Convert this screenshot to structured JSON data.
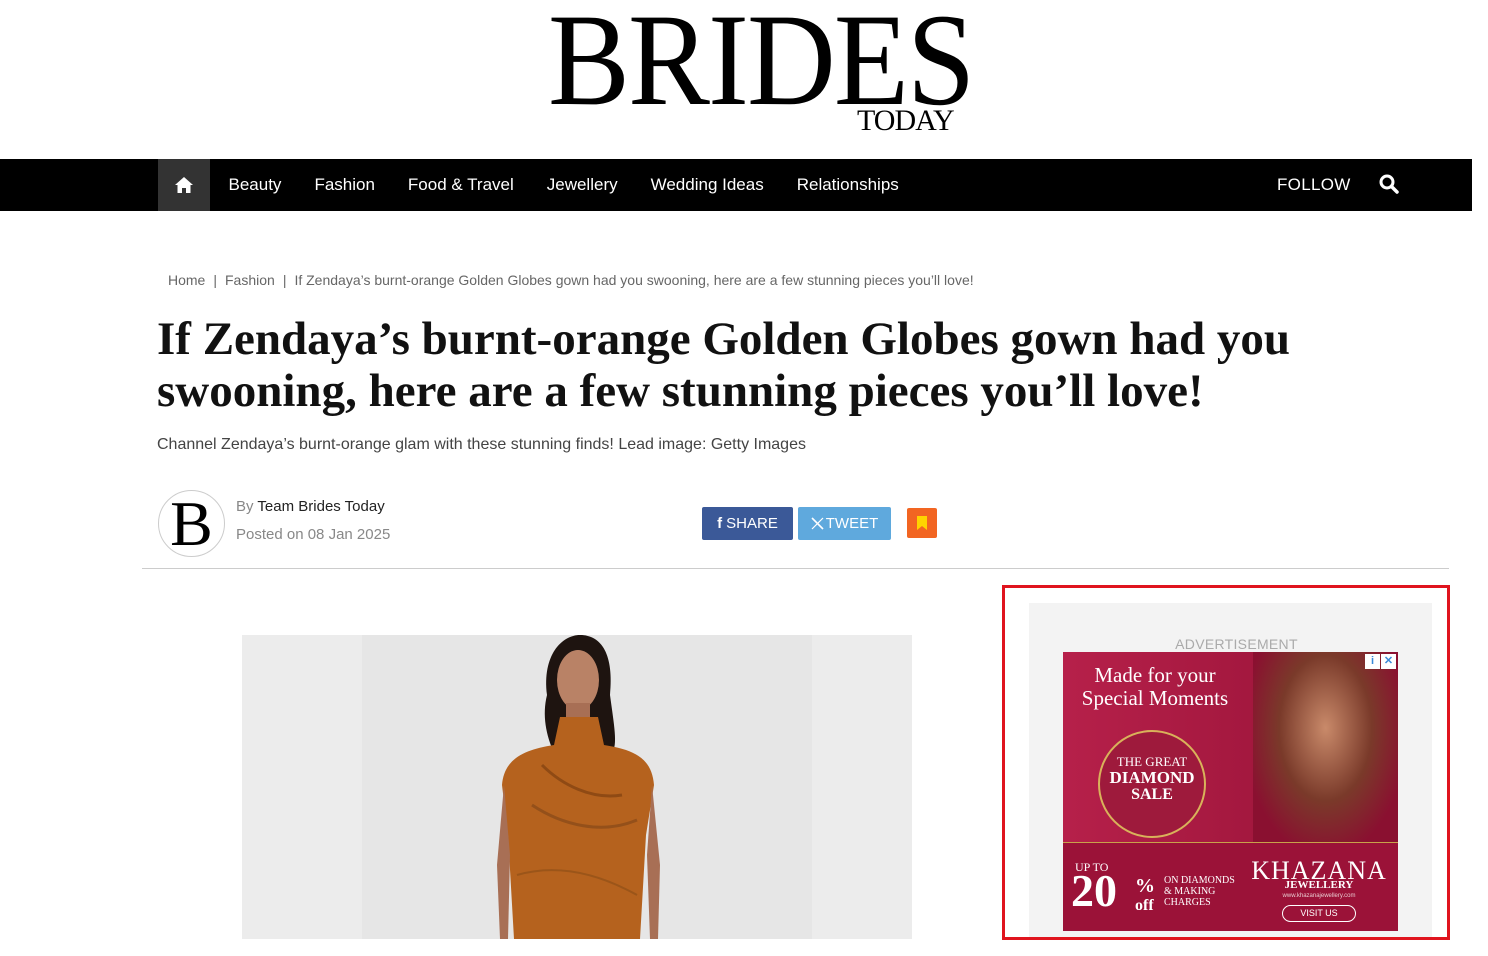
{
  "header": {
    "logo_main": "BRIDES",
    "logo_sub": "TODAY"
  },
  "nav": {
    "home_icon": "home-icon",
    "items": [
      "Beauty",
      "Fashion",
      "Food & Travel",
      "Jewellery",
      "Wedding Ideas",
      "Relationships"
    ],
    "follow_label": "FOLLOW",
    "search_icon": "search-icon"
  },
  "breadcrumb": {
    "home": "Home",
    "section": "Fashion",
    "current": "If Zendaya’s burnt-orange Golden Globes gown had you swooning, here are a few stunning pieces you’ll love!"
  },
  "article": {
    "title": "If Zendaya’s burnt-orange Golden Globes gown had you swooning, here are a few stunning pieces you’ll love!",
    "subtitle": "Channel Zendaya’s burnt-orange glam with these stunning finds! Lead image: Getty Images",
    "author_logo_letter": "B",
    "by_prefix": "By",
    "author": "Team Brides Today",
    "posted": "Posted on 08 Jan 2025"
  },
  "share": {
    "share_label": "SHARE",
    "tweet_label": "TWEET",
    "share_color": "#3b5998",
    "tweet_color": "#5fa9dd",
    "bookmark_color": "#f26522"
  },
  "ad": {
    "label": "ADVERTISEMENT",
    "headline": "Made for your Special Moments",
    "badge_line1": "THE GREAT",
    "badge_line2": "DIAMOND",
    "badge_line3": "SALE",
    "up_to": "UP TO",
    "percent": "20",
    "percent_sign": "%",
    "off": "off",
    "on_text": "ON DIAMONDS & MAKING CHARGES",
    "brand": "KHAZANA",
    "brand_sub": "JEWELLERY",
    "url": "www.khazanajewellery.com",
    "visit": "VISIT US",
    "highlight_color": "#e0141e"
  }
}
